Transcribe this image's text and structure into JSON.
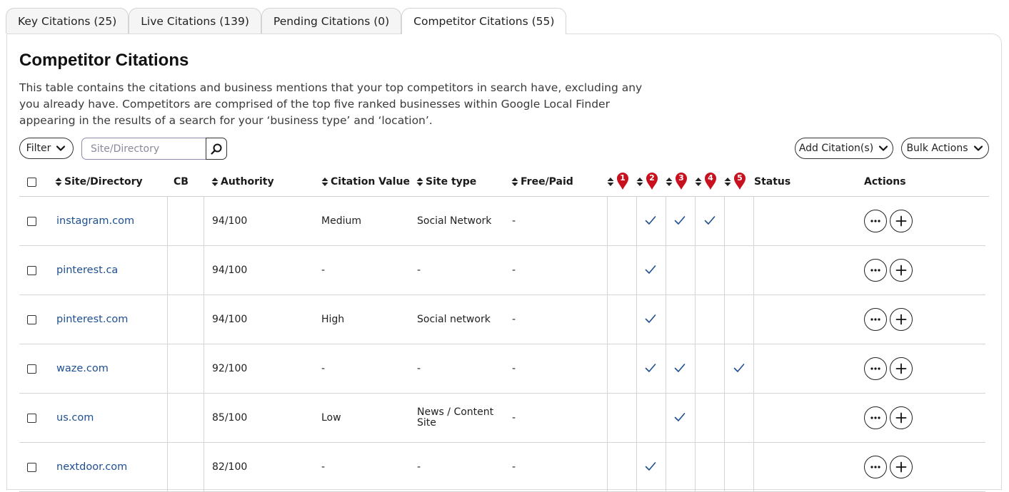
{
  "tabs": [
    {
      "label": "Key Citations (25)",
      "active": false
    },
    {
      "label": "Live Citations (139)",
      "active": false
    },
    {
      "label": "Pending Citations (0)",
      "active": false
    },
    {
      "label": "Competitor Citations (55)",
      "active": true
    }
  ],
  "page": {
    "title": "Competitor Citations",
    "description": "This table contains the citations and business mentions that your top competitors in search have, excluding any you already have. Competitors are comprised of the top five ranked businesses within Google Local Finder appearing in the results of a search for your ‘business type’ and ‘location’."
  },
  "toolbar": {
    "filter_label": "Filter",
    "search_placeholder": "Site/Directory",
    "add_label": "Add Citation(s)",
    "bulk_label": "Bulk Actions"
  },
  "columns": {
    "site": "Site/Directory",
    "cb": "CB",
    "authority": "Authority",
    "value": "Citation Value",
    "type": "Site type",
    "free_paid": "Free/Paid",
    "competitors": [
      "1",
      "2",
      "3",
      "4",
      "5"
    ],
    "status": "Status",
    "actions": "Actions"
  },
  "rows": [
    {
      "site": "instagram.com",
      "cb": "",
      "authority": "94/100",
      "value": "Medium",
      "type": "Social Network",
      "free_paid": "-",
      "competitors": [
        false,
        true,
        true,
        true,
        false
      ],
      "status": ""
    },
    {
      "site": "pinterest.ca",
      "cb": "",
      "authority": "94/100",
      "value": "-",
      "type": "-",
      "free_paid": "-",
      "competitors": [
        false,
        true,
        false,
        false,
        false
      ],
      "status": ""
    },
    {
      "site": "pinterest.com",
      "cb": "",
      "authority": "94/100",
      "value": "High",
      "type": "Social network",
      "free_paid": "-",
      "competitors": [
        false,
        true,
        false,
        false,
        false
      ],
      "status": ""
    },
    {
      "site": "waze.com",
      "cb": "",
      "authority": "92/100",
      "value": "-",
      "type": "-",
      "free_paid": "-",
      "competitors": [
        false,
        true,
        true,
        false,
        true
      ],
      "status": ""
    },
    {
      "site": "us.com",
      "cb": "",
      "authority": "85/100",
      "value": "Low",
      "type": "News / Content Site",
      "free_paid": "-",
      "competitors": [
        false,
        false,
        true,
        false,
        false
      ],
      "status": ""
    },
    {
      "site": "nextdoor.com",
      "cb": "",
      "authority": "82/100",
      "value": "-",
      "type": "-",
      "free_paid": "-",
      "competitors": [
        false,
        true,
        false,
        false,
        false
      ],
      "status": ""
    }
  ],
  "colors": {
    "link": "#1d4f91",
    "check": "#1d4f91",
    "pin": "#c8101e"
  },
  "icons": {
    "sort": "sort-updown-icon",
    "competitor": "map-pin-icon",
    "check": "check-icon",
    "more": "more-horizontal-icon",
    "add": "plus-icon",
    "search": "search-icon",
    "dropdown": "chevron-down-icon"
  }
}
